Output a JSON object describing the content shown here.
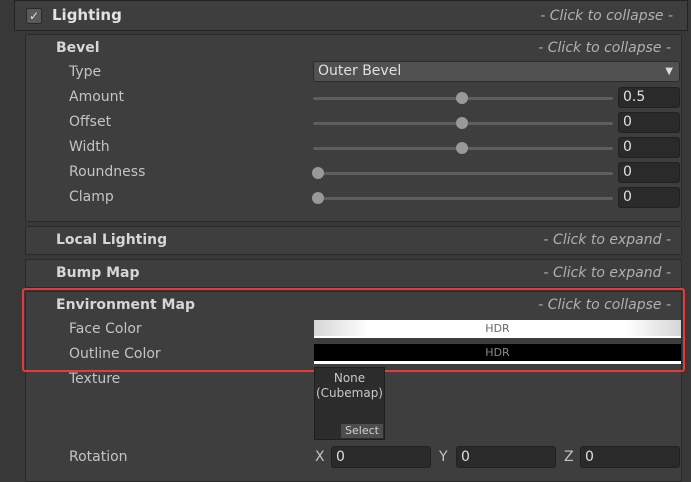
{
  "lighting": {
    "title": "Lighting",
    "hint": "- Click to collapse -",
    "check": "✓"
  },
  "bevel": {
    "title": "Bevel",
    "hint": "- Click to collapse -",
    "type_label": "Type",
    "type_value": "Outer Bevel",
    "rows": [
      {
        "label": "Amount",
        "value": "0.5",
        "fraction": 0.48
      },
      {
        "label": "Offset",
        "value": "0",
        "fraction": 0.48
      },
      {
        "label": "Width",
        "value": "0",
        "fraction": 0.48
      },
      {
        "label": "Roundness",
        "value": "0",
        "fraction": 0.0
      },
      {
        "label": "Clamp",
        "value": "0",
        "fraction": 0.0
      }
    ]
  },
  "local_lighting": {
    "title": "Local Lighting",
    "hint": "- Click to expand -"
  },
  "bump_map": {
    "title": "Bump Map",
    "hint": "- Click to expand -"
  },
  "environment_map": {
    "title": "Environment Map",
    "hint": "- Click to collapse -",
    "face_color_label": "Face Color",
    "face_color_text": "HDR",
    "outline_color_label": "Outline Color",
    "outline_color_text": "HDR",
    "texture_label": "Texture",
    "texture_line1": "None",
    "texture_line2": "(Cubemap)",
    "texture_select": "Select",
    "rotation_label": "Rotation",
    "rotation": {
      "x_label": "X",
      "x": "0",
      "y_label": "Y",
      "y": "0",
      "z_label": "Z",
      "z": "0"
    }
  },
  "colors": {
    "highlight": "#e53a3a",
    "face_color": "#f2f2f2",
    "outline_color": "#000000"
  }
}
